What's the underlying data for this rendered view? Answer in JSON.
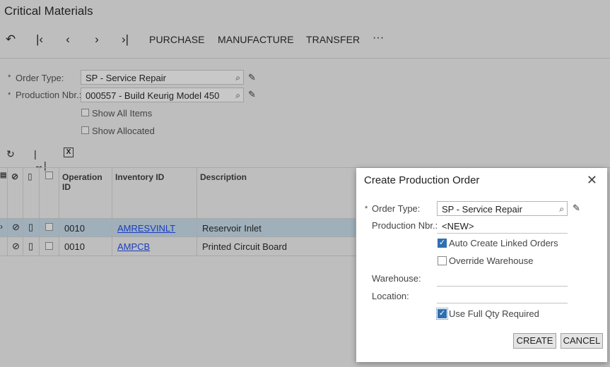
{
  "page_title": "Critical Materials",
  "toolbar": {
    "undo_icon": "undo-icon",
    "first_icon": "first-record-icon",
    "prev_icon": "previous-icon",
    "next_icon": "next-icon",
    "last_icon": "last-record-icon",
    "purchase": "PURCHASE",
    "manufacture": "MANUFACTURE",
    "transfer": "TRANSFER",
    "more": "···"
  },
  "form": {
    "order_type_label": "Order Type:",
    "order_type_value": "SP - Service Repair",
    "production_nbr_label": "Production Nbr.:",
    "production_nbr_value": "000557 - Build Keurig Model 450",
    "show_all_items": "Show All Items",
    "show_allocated": "Show Allocated"
  },
  "grid": {
    "columns": [
      "Operation ID",
      "Inventory ID",
      "Description"
    ],
    "rows": [
      {
        "operation": "0010",
        "inventory": "AMRESVINLT",
        "description": "Reservoir Inlet"
      },
      {
        "operation": "0010",
        "inventory": "AMPCB",
        "description": "Printed Circuit Board"
      }
    ]
  },
  "dialog": {
    "title": "Create Production Order",
    "order_type_label": "Order Type:",
    "order_type_value": "SP - Service Repair",
    "production_nbr_label": "Production Nbr.:",
    "production_nbr_value": "<NEW>",
    "auto_create": "Auto Create Linked Orders",
    "override_warehouse": "Override Warehouse",
    "warehouse_label": "Warehouse:",
    "location_label": "Location:",
    "use_full_qty": "Use Full Qty Required",
    "create": "CREATE",
    "cancel": "CANCEL"
  }
}
